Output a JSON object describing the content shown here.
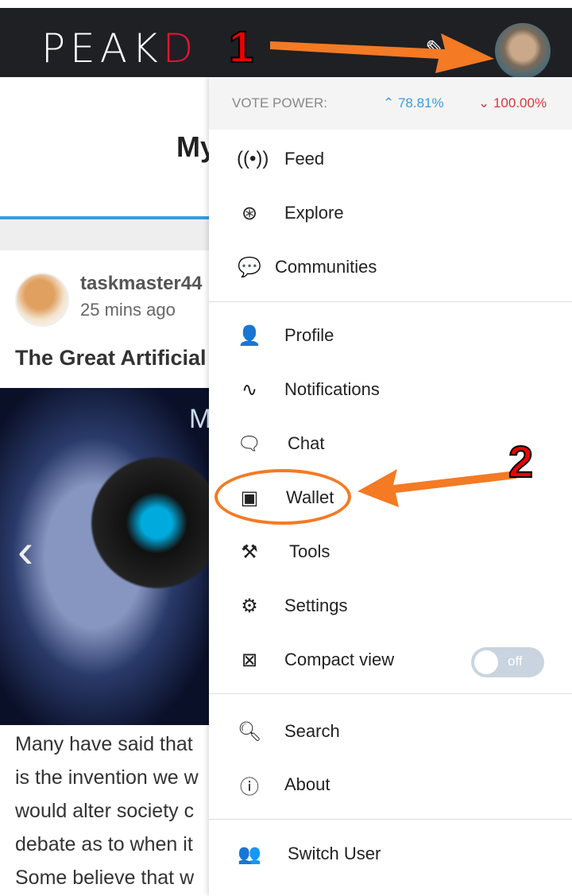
{
  "header": {
    "logo_text": "PEAK",
    "logo_accent": "D",
    "annotation_1": "1",
    "accent_color": "#e31337"
  },
  "page": {
    "title": "My"
  },
  "post": {
    "author": "taskmaster44",
    "time": "25 mins ago",
    "title": "The Great Artificial",
    "image_text": "M",
    "body_lines": [
      "Many have said that",
      "is the invention we w",
      "would alter society c",
      "debate as to when it",
      "Some believe that w"
    ]
  },
  "menu": {
    "vote_power_label": "VOTE POWER:",
    "upvote_power": "78.81%",
    "downvote_power": "100.00%",
    "items": [
      {
        "label": "Feed",
        "icon": "broadcast-icon"
      },
      {
        "label": "Explore",
        "icon": "compass-icon"
      },
      {
        "label": "Communities",
        "icon": "comments-icon"
      },
      {
        "label": "Profile",
        "icon": "user-icon"
      },
      {
        "label": "Notifications",
        "icon": "pulse-icon"
      },
      {
        "label": "Chat",
        "icon": "chat-icon"
      },
      {
        "label": "Wallet",
        "icon": "wallet-icon"
      },
      {
        "label": "Tools",
        "icon": "tools-icon"
      },
      {
        "label": "Settings",
        "icon": "gear-icon"
      },
      {
        "label": "Compact view",
        "icon": "compact-icon",
        "toggle": "off"
      },
      {
        "label": "Search",
        "icon": "search-icon"
      },
      {
        "label": "About",
        "icon": "info-icon"
      },
      {
        "label": "Switch User",
        "icon": "switch-user-icon"
      }
    ]
  },
  "annotation_2": "2",
  "annotation_color": "#f47a24"
}
